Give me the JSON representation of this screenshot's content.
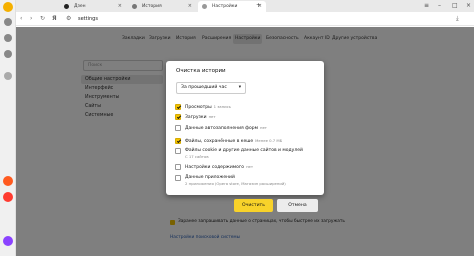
{
  "tabs": [
    {
      "label": "Дзен"
    },
    {
      "label": "История"
    },
    {
      "label": "Настройки"
    }
  ],
  "address": {
    "url": "settings"
  },
  "topnav": [
    "Закладки",
    "Загрузки",
    "История",
    "Расширения",
    "Настройки",
    "Безопасность",
    "Аккаунт ID",
    "Другие устройства"
  ],
  "search": {
    "placeholder": "Поиск"
  },
  "sidenav": [
    "Общие настройки",
    "Интерфейс",
    "Инструменты",
    "Сайты",
    "Системные"
  ],
  "background": {
    "option_text": "Заранее запрашивать данные о страницах, чтобы быстрее их загружать",
    "link": "Настройки поисковой системы"
  },
  "dialog": {
    "title": "Очистка истории",
    "period": "За прошедший час",
    "options": [
      {
        "label": "Просмотры",
        "detail": "1 запись",
        "sub": "",
        "checked": true
      },
      {
        "label": "Загрузки",
        "detail": "нет",
        "sub": "",
        "checked": true
      },
      {
        "label": "Данные автозаполнения форм",
        "detail": "нет",
        "sub": "",
        "checked": false
      },
      {
        "label": "Файлы, сохранённые в кеше",
        "detail": "Менее 0.7 МБ",
        "sub": "",
        "checked": true
      },
      {
        "label": "Файлы cookie и другие данные сайтов и модулей",
        "detail": "",
        "sub": "С 17 сайтов",
        "checked": false
      },
      {
        "label": "Настройки содержимого",
        "detail": "нет",
        "sub": "",
        "checked": false
      },
      {
        "label": "Данные приложений",
        "detail": "",
        "sub": "2 приложения (Opera store, Магазин расширений)",
        "checked": false
      }
    ],
    "clear_label": "Очистить",
    "cancel_label": "Отмена"
  },
  "colors": {
    "accent": "#f8d22a",
    "check": "#f2c200",
    "link": "#2a5fb5"
  }
}
